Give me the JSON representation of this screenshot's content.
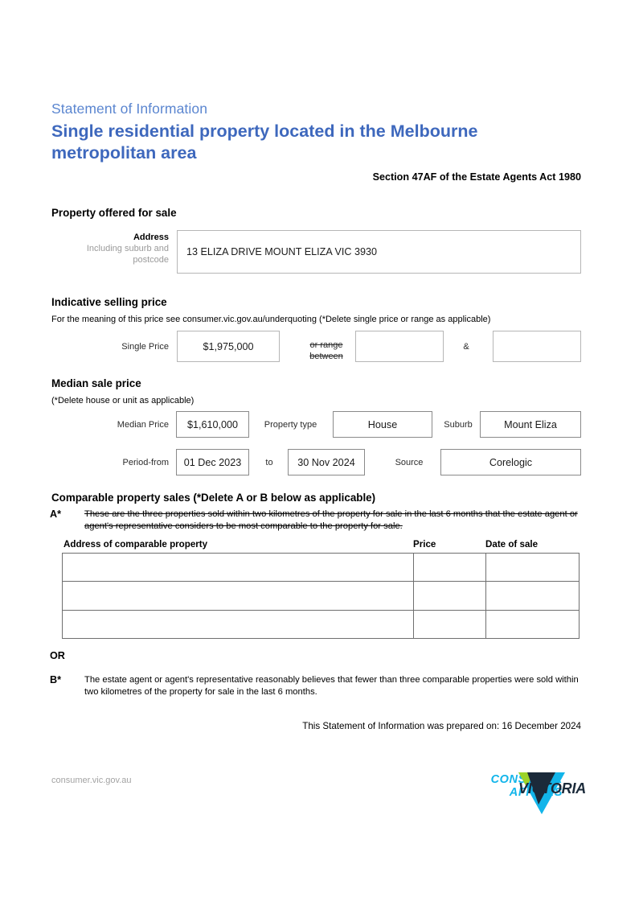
{
  "header": {
    "kicker": "Statement of Information",
    "title": "Single residential property located in the Melbourne metropolitan area",
    "section_ref": "Section 47AF of the Estate Agents Act 1980"
  },
  "property_offered": {
    "heading": "Property offered for sale",
    "address_label": "Address",
    "address_sub_label": "Including suburb and postcode",
    "address_value": "13 ELIZA DRIVE MOUNT ELIZA VIC 3930"
  },
  "indicative_price": {
    "heading": "Indicative selling price",
    "note": "For the meaning of this price see consumer.vic.gov.au/underquoting (*Delete single price or range as applicable)",
    "single_price_label": "Single Price",
    "single_price_value": "$1,975,000",
    "range_label_line1": "or range",
    "range_label_line2": "between",
    "range_low_value": "",
    "ampersand": "&",
    "range_high_value": ""
  },
  "median_price": {
    "heading": "Median sale price",
    "note": "(*Delete house or unit as applicable)",
    "median_price_label": "Median Price",
    "median_price_value": "$1,610,000",
    "property_type_label": "Property type",
    "property_type_value": "House",
    "suburb_label": "Suburb",
    "suburb_value": "Mount Eliza",
    "period_from_label": "Period-from",
    "period_from_value": "01 Dec 2023",
    "to_label": "to",
    "period_to_value": "30 Nov 2024",
    "source_label": "Source",
    "source_value": "Corelogic"
  },
  "comparable": {
    "heading": "Comparable property sales (*Delete A or B below as applicable)",
    "a_marker": "A*",
    "a_text": "These are the three properties sold within two kilometres of the property for sale in the last 6 months that the estate agent or agent's representative considers to be most comparable to the property for sale.",
    "columns": [
      "Address of comparable property",
      "Price",
      "Date of sale"
    ],
    "rows": [
      {
        "address": "",
        "price": "",
        "date": ""
      },
      {
        "address": "",
        "price": "",
        "date": ""
      },
      {
        "address": "",
        "price": "",
        "date": ""
      }
    ],
    "or_label": "OR",
    "b_marker": "B*",
    "b_text": "The estate agent or agent's representative reasonably believes that fewer than three comparable properties were sold within two kilometres of the property for sale in the last 6 months."
  },
  "prepared": {
    "text": "This Statement of Information was prepared on: 16 December 2024"
  },
  "footer": {
    "url": "consumer.vic.gov.au",
    "logo_line1": "CONSUMER",
    "logo_line2": "AFFAIRS",
    "logo_victoria": "VICTORIA"
  },
  "colors": {
    "kicker_blue": "#5b86d0",
    "title_blue": "#3e68bd",
    "logo_cyan": "#12b5ea",
    "logo_navy": "#1b2a3a",
    "logo_green": "#9cd32a",
    "box_border": "#b6b6b6"
  }
}
